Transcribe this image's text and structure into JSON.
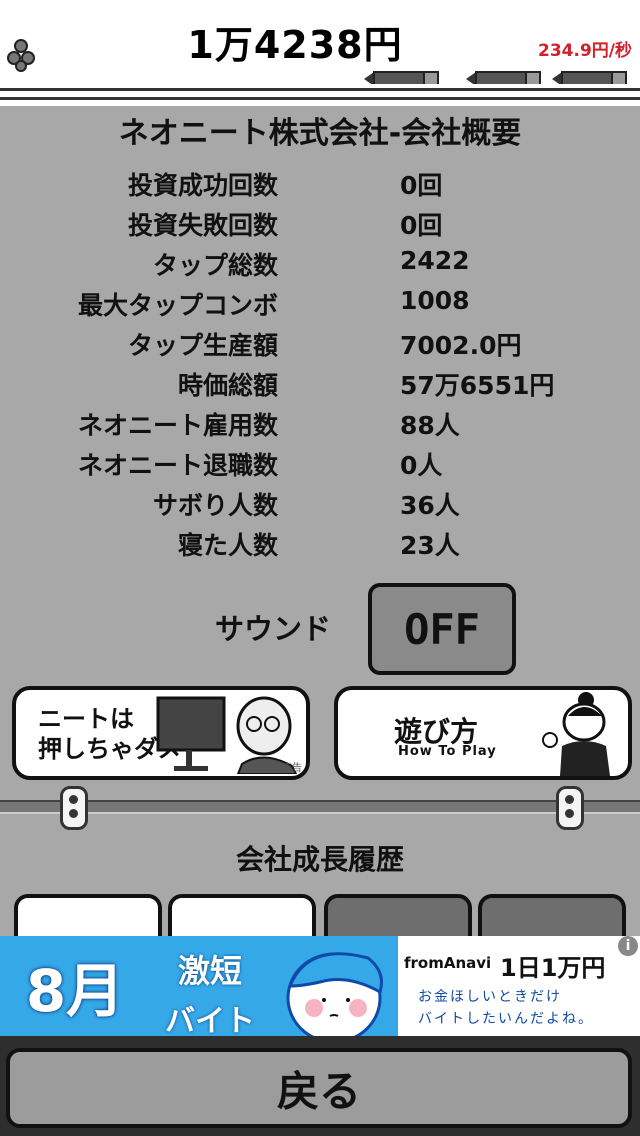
{
  "header": {
    "money": "1万4238円",
    "rate": "234.9円/秒"
  },
  "title": "ネオニート株式会社-会社概要",
  "stats": [
    {
      "label": "投資成功回数",
      "value": "0回"
    },
    {
      "label": "投資失敗回数",
      "value": "0回"
    },
    {
      "label": "タップ総数",
      "value": "2422"
    },
    {
      "label": "最大タップコンボ",
      "value": "1008"
    },
    {
      "label": "タップ生産額",
      "value": "7002.0円"
    },
    {
      "label": "時価総額",
      "value": "57万6551円"
    },
    {
      "label": "ネオニート雇用数",
      "value": "88人"
    },
    {
      "label": "ネオニート退職数",
      "value": "0人"
    },
    {
      "label": "サボり人数",
      "value": "36人"
    },
    {
      "label": "寝た人数",
      "value": "23人"
    }
  ],
  "sound": {
    "label": "サウンド",
    "toggle": "OFF"
  },
  "banners": {
    "left_line1": "ニートは",
    "left_line2": "押しちゃダメ",
    "left_small": "広告",
    "right_title": "遊び方",
    "right_sub": "How To Play"
  },
  "history": {
    "title": "会社成長履歴"
  },
  "ad": {
    "month": "8月",
    "short1": "激短",
    "short2": "バイト",
    "brand": "fromAnavi",
    "amount": "1日1万円",
    "tag1": "お金ほしいときだけ",
    "tag2": "バイトしたいんだよね。",
    "info": "i"
  },
  "footer": {
    "back_label": "戻る"
  },
  "colors": {
    "rate": "#d4202a",
    "background": "#a8a8a8",
    "ad_blue": "#35a9e8"
  }
}
